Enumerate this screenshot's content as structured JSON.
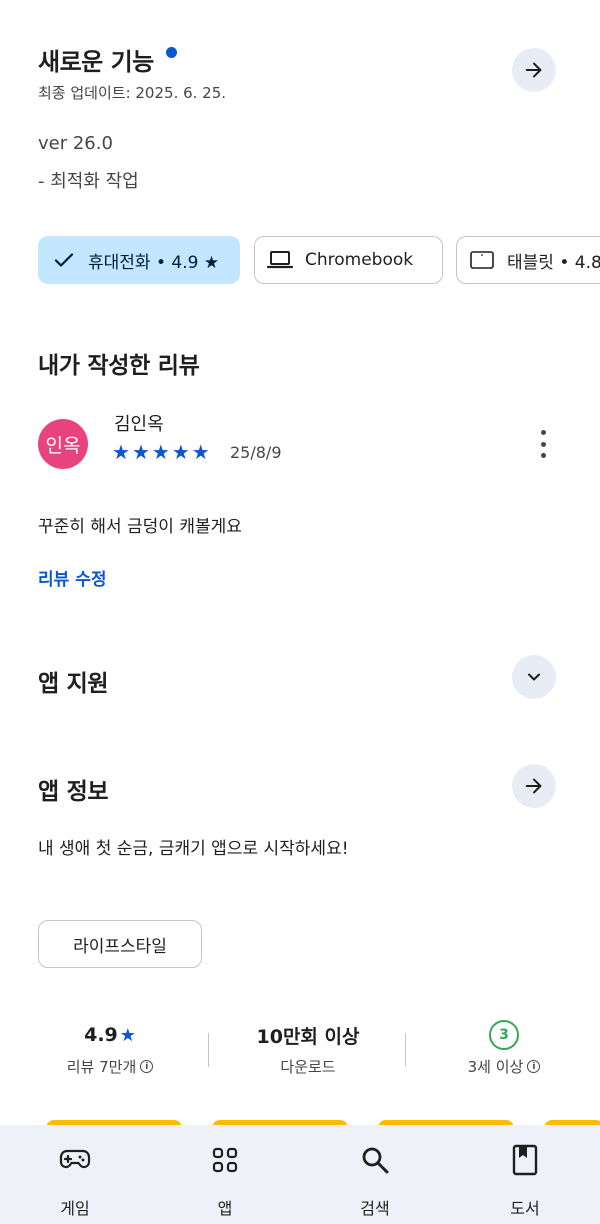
{
  "whats_new": {
    "title": "새로운 기능",
    "updated": "최종 업데이트: 2025. 6. 25.",
    "version": "ver 26.0",
    "note": "- 최적화 작업"
  },
  "device_chips": [
    {
      "label": "휴대전화 • 4.9 ★",
      "selected": true
    },
    {
      "label": "Chromebook",
      "selected": false
    },
    {
      "label": "태블릿 • 4.8",
      "selected": false
    }
  ],
  "my_review": {
    "title": "내가 작성한 리뷰",
    "avatar_text": "인옥",
    "avatar_color": "#e8437c",
    "reviewer": "김인옥",
    "stars": 5,
    "date": "25/8/9",
    "text": "꾸준히 해서 금덩이 캐볼게요",
    "edit_label": "리뷰 수정"
  },
  "app_support": {
    "title": "앱 지원"
  },
  "app_info": {
    "title": "앱 정보",
    "description": "내 생애 첫 순금, 금캐기 앱으로 시작하세요!",
    "category": "라이프스타일"
  },
  "stats": {
    "rating_value": "4.9",
    "rating_star": "★",
    "reviews_label": "리뷰 7만개",
    "downloads_value": "10만회 이상",
    "downloads_label": "다운로드",
    "age_badge": "3",
    "age_label": "3세 이상"
  },
  "bottom_nav": {
    "games": "게임",
    "apps": "앱",
    "search": "검색",
    "books": "도서"
  },
  "colors": {
    "accent": "#0b57d0",
    "chip_selected": "#c2e7ff",
    "age_green": "#34a853",
    "peek_yellow": "#fbbc04"
  }
}
